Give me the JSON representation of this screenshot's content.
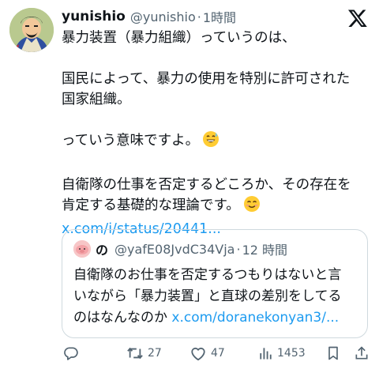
{
  "post": {
    "display_name": "yunishio",
    "handle": "@yunishio",
    "separator": "·",
    "time": "1時間",
    "lines": [
      "暴力装置（暴力組織）っていうのは、",
      "国民によって、暴力の使用を特別に許可された",
      "国家組織。",
      "っていう意味ですよ。",
      "自衛隊の仕事を否定するどころか、その存在を",
      "肯定する基礎的な理論です。"
    ],
    "link": "x.com/i/status/20441..."
  },
  "quoted": {
    "display_name": "の",
    "handle": "@yafE08JvdC34Vja",
    "separator": "·",
    "time": "12 時間",
    "lines": [
      "自衛隊のお仕事を否定するつもりはないと言",
      "いながら「暴力装置」と直球の差別をしてる",
      "のはなんなのか"
    ],
    "link": "x.com/doranekonyan3/..."
  },
  "actions": {
    "reply_count": "",
    "retweet_count": "27",
    "like_count": "47",
    "views_count": "1453"
  },
  "icons": [
    "x-logo-icon",
    "reply-icon",
    "retweet-icon",
    "like-icon",
    "views-icon",
    "bookmark-icon",
    "share-icon",
    "sweat-smile-emoji",
    "smile-emoji"
  ],
  "colors": {
    "link": "#1d9bf0",
    "text": "#0f1419",
    "muted": "#536471",
    "border": "#cfd9de"
  }
}
